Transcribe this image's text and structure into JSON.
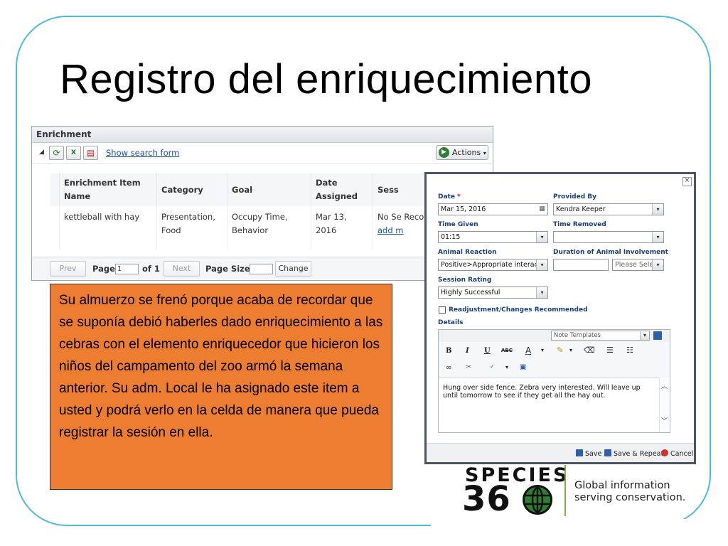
{
  "slide": {
    "title": "Registro del enriquecimiento"
  },
  "enrichment_panel": {
    "header": "Enrichment",
    "show_search_link": "Show search form",
    "actions_label": "Actions",
    "columns": [
      "Enrichment Item Name",
      "Category",
      "Goal",
      "Date Assigned",
      "Sess"
    ],
    "rows": [
      {
        "item": "kettleball with hay",
        "category": "Presentation, Food",
        "goal": "Occupy Time, Behavior",
        "date": "Mar 13, 2016",
        "session": "No Se Reco",
        "session_link": "add m"
      }
    ],
    "pager": {
      "prev": "Prev",
      "page_label": "Page",
      "page_value": "1",
      "of_label": "of 1",
      "next": "Next",
      "page_size_label": "Page Size",
      "change": "Change"
    }
  },
  "callout": {
    "text": "Su almuerzo se frenó porque acaba de recordar que se suponía debió haberles dado enriquecimiento a las cebras con el elemento enriquecedor que hicieron los niños del campamento del zoo armó la semana anterior. Su adm. Local le ha asignado este item a usted y podrá verlo en la celda de manera que pueda registrar la sesión en ella."
  },
  "session_dialog": {
    "close": "×",
    "date_label": "Date",
    "required_mark": "*",
    "date_value": "Mar 15, 2016",
    "provided_by_label": "Provided By",
    "provided_by_value": "Kendra Keeper",
    "time_given_label": "Time Given",
    "time_given_value": "01:15",
    "time_removed_label": "Time Removed",
    "time_removed_value": "",
    "animal_reaction_label": "Animal Reaction",
    "animal_reaction_value": "Positive>Appropriate interactio",
    "duration_label": "Duration of Animal Involvement",
    "duration_unit_placeholder": "Please Selec",
    "session_rating_label": "Session Rating",
    "session_rating_value": "Highly Successful",
    "readjustment_label": "Readjustment/Changes Recommended",
    "details_label": "Details",
    "note_templates": "Note Templates",
    "details_text": "Hung over side fence. Zebra very interested. Will leave up until tomorrow to see if they get all the hay out.",
    "save": "Save",
    "save_repeat": "Save & Repeat",
    "cancel": "Cancel"
  },
  "logo": {
    "species": "SPECIES",
    "number": "360",
    "tagline_line1": "Global information",
    "tagline_line2": "serving conservation."
  },
  "colors": {
    "frame": "#4fb9dc",
    "callout": "#ed7d31",
    "label_blue": "#1a3d78",
    "link": "#1a4fa0",
    "logo_green": "#2e7d32"
  }
}
